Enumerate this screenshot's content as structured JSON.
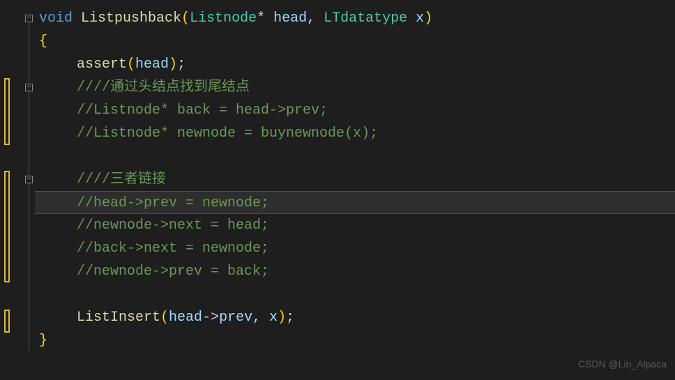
{
  "code": {
    "line1": {
      "kw": "void",
      "func": " Listpushback",
      "paren1": "(",
      "type1": "Listnode",
      "star": "* ",
      "param1": "head",
      "comma": ", ",
      "type2": "LTdatatype",
      "sp": " ",
      "param2": "x",
      "paren2": ")"
    },
    "line2": "{",
    "line3": {
      "func": "assert",
      "paren1": "(",
      "param": "head",
      "paren2": ")",
      "semi": ";"
    },
    "line4": "////通过头结点找到尾结点",
    "line5": "//Listnode* back = head->prev;",
    "line6": "//Listnode* newnode = buynewnode(x);",
    "line7": "",
    "line8": "////三者链接",
    "line9": "//head->prev = newnode;",
    "line10": "//newnode->next = head;",
    "line11": "//back->next = newnode;",
    "line12": "//newnode->prev = back;",
    "line13": "",
    "line14": {
      "func": "ListInsert",
      "paren1": "(",
      "param1": "head",
      "arrow": "->",
      "member": "prev",
      "comma": ", ",
      "param2": "x",
      "paren2": ")",
      "semi": ";"
    },
    "line15": "}"
  },
  "watermark": "CSDN @Lin_Alpaca"
}
